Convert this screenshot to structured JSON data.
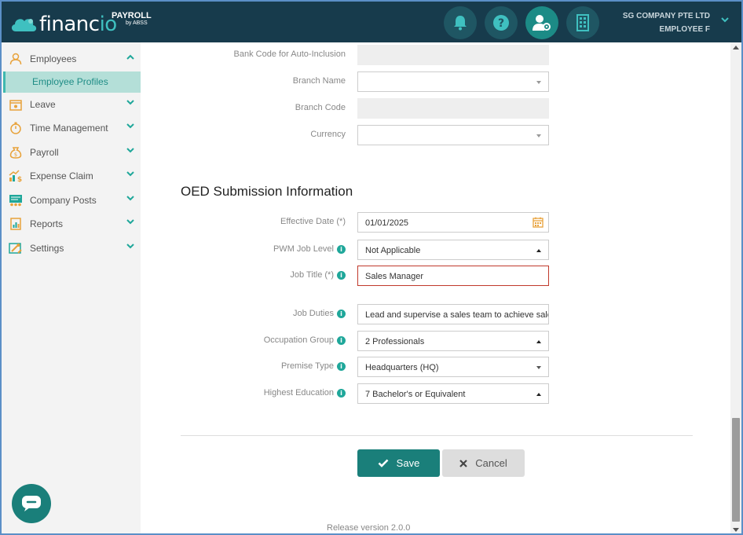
{
  "header": {
    "brand_main": "financ",
    "brand_accent": "io",
    "brand_payroll": "PAYROLL",
    "brand_by": "by ABSS",
    "company_name": "SG COMPANY PTE LTD",
    "user_name": "EMPLOYEE F"
  },
  "sidebar": {
    "items": [
      {
        "label": "Employees"
      },
      {
        "label": "Leave"
      },
      {
        "label": "Time Management"
      },
      {
        "label": "Payroll"
      },
      {
        "label": "Expense Claim"
      },
      {
        "label": "Company Posts"
      },
      {
        "label": "Reports"
      },
      {
        "label": "Settings"
      }
    ],
    "subitem": "Employee Profiles"
  },
  "bank": {
    "bank_code_label": "Bank Code for Auto-Inclusion",
    "bank_code_value": "",
    "branch_name_label": "Branch Name",
    "branch_name_value": "",
    "branch_code_label": "Branch Code",
    "branch_code_value": "",
    "currency_label": "Currency",
    "currency_value": ""
  },
  "oed": {
    "title": "OED Submission Information",
    "effective_date_label": "Effective Date (*)",
    "effective_date_value": "01/01/2025",
    "pwm_label": "PWM Job Level",
    "pwm_value": "Not Applicable",
    "job_title_label": "Job Title (*)",
    "job_title_value": "Sales Manager",
    "job_duties_label": "Job Duties",
    "job_duties_value": "Lead and supervise a sales team to achieve sales targets",
    "occupation_label": "Occupation Group",
    "occupation_value": "2 Professionals",
    "premise_label": "Premise Type",
    "premise_value": "Headquarters (HQ)",
    "education_label": "Highest Education",
    "education_value": "7 Bachelor's or Equivalent"
  },
  "actions": {
    "save_label": "Save",
    "cancel_label": "Cancel"
  },
  "footer": {
    "release": "Release version 2.0.0"
  },
  "colors": {
    "header_bg": "#173b4c",
    "accent": "#1a7f7a",
    "error": "#c0392b"
  }
}
